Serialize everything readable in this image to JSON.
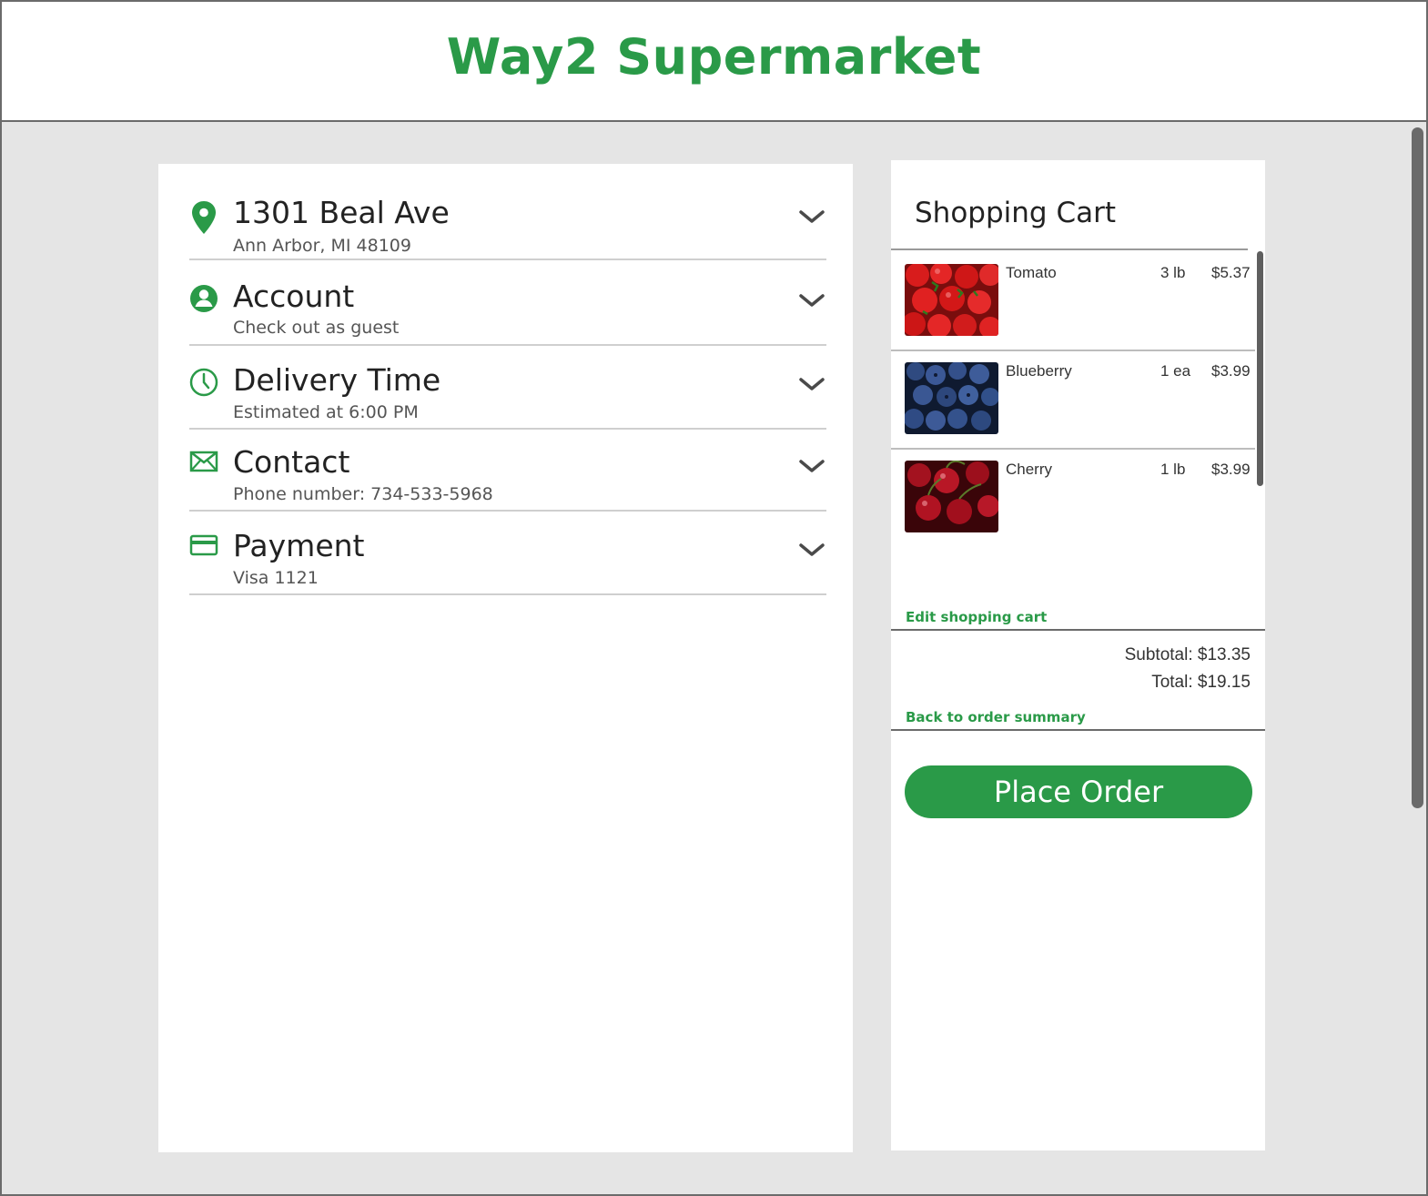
{
  "header": {
    "title": "Way2 Supermarket"
  },
  "checkout": {
    "sections": [
      {
        "icon": "location-pin-icon",
        "title": "1301 Beal Ave",
        "subtitle": "Ann Arbor, MI 48109"
      },
      {
        "icon": "user-icon",
        "title": "Account",
        "subtitle": "Check out as guest"
      },
      {
        "icon": "clock-icon",
        "title": "Delivery Time",
        "subtitle": "Estimated at 6:00 PM"
      },
      {
        "icon": "mail-icon",
        "title": "Contact",
        "subtitle": "Phone number: 734-533-5968"
      },
      {
        "icon": "credit-card-icon",
        "title": "Payment",
        "subtitle": "Visa 1121"
      }
    ]
  },
  "cart": {
    "title": "Shopping Cart",
    "items": [
      {
        "name": "Tomato",
        "qty": "3 lb",
        "price": "$5.37",
        "image": "tomato-image"
      },
      {
        "name": "Blueberry",
        "qty": "1 ea",
        "price": "$3.99",
        "image": "blueberry-image"
      },
      {
        "name": "Cherry",
        "qty": "1 lb",
        "price": "$3.99",
        "image": "cherry-image"
      }
    ],
    "edit_link": "Edit shopping cart",
    "subtotal": "Subtotal: $13.35",
    "total": "Total: $19.15",
    "back_link": "Back to order summary",
    "place_order": "Place Order"
  },
  "colors": {
    "accent": "#2a9a48",
    "background": "#e5e5e5",
    "panel": "#ffffff"
  }
}
